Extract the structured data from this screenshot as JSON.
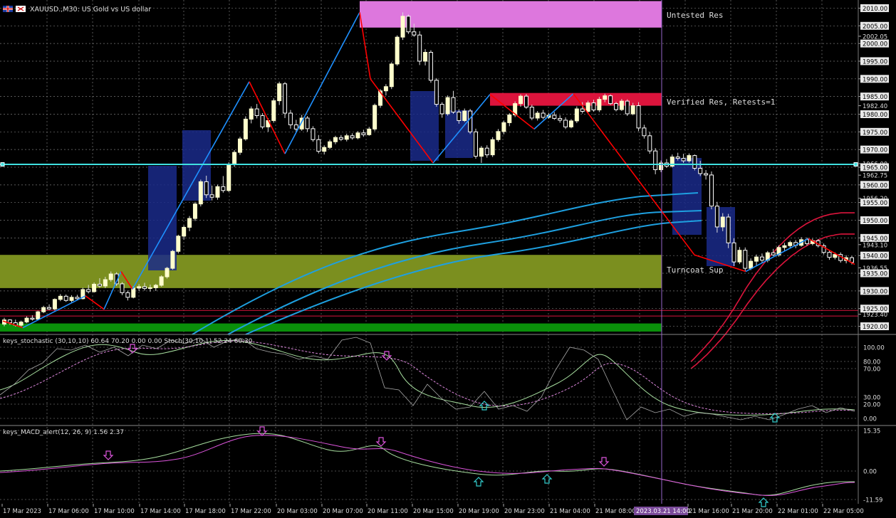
{
  "header": {
    "symbol_text": "XAUUSD.,M30:  US Gold vs US dollar",
    "flag_icon": "uk-flag-icon",
    "close_icon": "close-icon"
  },
  "annotations": {
    "untested": "Untested Res",
    "verified": "Verified Res, Retests=1",
    "turncoat": "Turncoat Sup"
  },
  "colors": {
    "background": "#000000",
    "bull_candle": "#ffffcc",
    "bear_candle": "#ffffff",
    "zigzag_up": "#1e90ff",
    "zigzag_down": "#ff0000",
    "untested_res": "#dd77dd",
    "verified_res": "#dc143c",
    "turncoat_sup": "#7b8f1f",
    "bottom_sup": "#0a8f0a",
    "cyan_line": "#40e0e0",
    "ma_blue": "#1ea0e0",
    "ma_red": "#dc143c",
    "stoch_main": "#a8e0a0",
    "stoch_signal": "#dd88dd",
    "macd_main": "#a8e0a0",
    "macd_signal": "#dd55dd",
    "box_navy": "#1a2a8a",
    "cursor_line": "#9966cc"
  },
  "price_axis": {
    "labels": [
      "2010.00",
      "2005.00",
      "2002.05",
      "2000.00",
      "1995.00",
      "1990.00",
      "1985.00",
      "1982.40",
      "1980.00",
      "1975.00",
      "1970.00",
      "1966.00",
      "1965.00",
      "1962.75",
      "1960.00",
      "1956.20",
      "1955.00",
      "1950.00",
      "1945.00",
      "1943.10",
      "1940.00",
      "1936.55",
      "1935.00",
      "1930.00",
      "1925.00",
      "1923.40",
      "1920.00"
    ],
    "range": [
      1918.5,
      2011.5
    ]
  },
  "stoch_panel": {
    "title": "keys_stochastic (30,10,10) 60.64 70.20 0.00 0.00 Stoch(30,10,1) 52.24 60.30",
    "axis": [
      "100.00",
      "80.00",
      "70.00",
      "30.00",
      "20.00",
      "0.00"
    ]
  },
  "macd_panel": {
    "title": "keys_MACD_alert(12, 26, 9) 1.56 2.37",
    "axis": [
      "15.35",
      "0.00",
      "-11.59"
    ]
  },
  "time_axis": {
    "labels": [
      "17 Mar 2023",
      "17 Mar 06:00",
      "17 Mar 10:00",
      "17 Mar 14:00",
      "17 Mar 18:00",
      "17 Mar 22:00",
      "20 Mar 03:00",
      "20 Mar 07:00",
      "20 Mar 11:00",
      "20 Mar 15:00",
      "20 Mar 19:00",
      "20 Mar 23:00",
      "21 Mar 04:00",
      "21 Mar 08:00",
      "21 Mar 16:00",
      "21 Mar 20:00",
      "22 Mar 01:00",
      "22 Mar 05:00"
    ],
    "cursor_label": "2023.03.21 14:00"
  },
  "chart_data": {
    "type": "candlestick",
    "title": "XAUUSD.,M30:  US Gold vs US dollar",
    "price_range": [
      1918.5,
      2011.5
    ],
    "horizontal_line": 1965.8,
    "zones": [
      {
        "label": "Untested Res",
        "low": 2004.5,
        "high": 2012
      },
      {
        "label": "Verified Res, Retests=1",
        "low": 1982.4,
        "high": 1986.0
      },
      {
        "label": "Turncoat Sup",
        "low": 1930.8,
        "high": 1940.2
      },
      {
        "label": "",
        "low": 1918.5,
        "high": 1920.8
      }
    ],
    "zigzag": [
      [
        0,
        1921.5
      ],
      [
        1,
        1919.6
      ],
      [
        2,
        1928.6
      ],
      [
        3,
        1924.8
      ],
      [
        4,
        1935.5
      ],
      [
        5,
        1930.5
      ],
      [
        6,
        1989.2
      ],
      [
        7,
        1968.8
      ],
      [
        8,
        2008.8
      ],
      [
        9,
        1990.0
      ],
      [
        10,
        1966.2
      ],
      [
        11,
        1985.6
      ],
      [
        12,
        1975.8
      ],
      [
        13,
        1985.8
      ],
      [
        14,
        1940.2
      ],
      [
        15,
        1935.5
      ],
      [
        16,
        1944.8
      ],
      [
        17,
        1937.5
      ]
    ],
    "candles": [
      [
        1920.6,
        1922.4,
        1920.0,
        1921.8
      ],
      [
        1921.8,
        1922.0,
        1920.4,
        1921.0
      ],
      [
        1921.0,
        1921.9,
        1919.9,
        1920.3
      ],
      [
        1920.3,
        1921.6,
        1919.7,
        1921.2
      ],
      [
        1921.2,
        1922.8,
        1920.9,
        1922.3
      ],
      [
        1922.3,
        1923.1,
        1921.6,
        1922.0
      ],
      [
        1922.0,
        1924.4,
        1921.8,
        1924.1
      ],
      [
        1924.1,
        1925.8,
        1923.7,
        1925.3
      ],
      [
        1925.3,
        1926.2,
        1924.6,
        1924.9
      ],
      [
        1924.9,
        1927.9,
        1924.5,
        1927.6
      ],
      [
        1927.6,
        1929.1,
        1927.1,
        1928.5
      ],
      [
        1928.5,
        1929.0,
        1926.9,
        1927.3
      ],
      [
        1927.3,
        1928.8,
        1926.8,
        1928.2
      ],
      [
        1928.2,
        1928.9,
        1927.4,
        1927.8
      ],
      [
        1927.8,
        1930.9,
        1927.6,
        1930.4
      ],
      [
        1930.4,
        1931.7,
        1929.3,
        1929.8
      ],
      [
        1929.8,
        1932.4,
        1929.5,
        1931.9
      ],
      [
        1931.9,
        1933.6,
        1930.9,
        1931.4
      ],
      [
        1931.4,
        1934.0,
        1930.8,
        1933.2
      ],
      [
        1933.2,
        1935.5,
        1932.6,
        1934.8
      ],
      [
        1934.8,
        1935.3,
        1931.4,
        1932.0
      ],
      [
        1932.0,
        1932.5,
        1928.8,
        1929.5
      ],
      [
        1929.5,
        1930.1,
        1927.3,
        1928.2
      ],
      [
        1928.2,
        1931.4,
        1927.9,
        1930.8
      ],
      [
        1930.8,
        1931.9,
        1930.0,
        1931.2
      ],
      [
        1931.2,
        1932.3,
        1930.1,
        1930.7
      ],
      [
        1930.7,
        1931.8,
        1929.8,
        1930.9
      ],
      [
        1930.9,
        1932.0,
        1930.0,
        1931.6
      ],
      [
        1931.6,
        1934.4,
        1931.2,
        1934.0
      ],
      [
        1934.0,
        1936.8,
        1933.5,
        1936.4
      ],
      [
        1936.4,
        1941.6,
        1936.0,
        1941.2
      ],
      [
        1941.2,
        1945.9,
        1940.6,
        1945.5
      ],
      [
        1945.5,
        1948.5,
        1944.5,
        1948.0
      ],
      [
        1948.0,
        1951.2,
        1946.9,
        1950.5
      ],
      [
        1950.5,
        1955.2,
        1949.8,
        1954.6
      ],
      [
        1954.6,
        1961.5,
        1953.9,
        1960.9
      ],
      [
        1960.9,
        1962.6,
        1956.3,
        1957.2
      ],
      [
        1957.2,
        1959.8,
        1955.6,
        1956.5
      ],
      [
        1956.5,
        1960.1,
        1955.8,
        1959.5
      ],
      [
        1959.5,
        1962.5,
        1957.8,
        1958.4
      ],
      [
        1958.4,
        1966.4,
        1958.0,
        1965.7
      ],
      [
        1965.7,
        1969.8,
        1965.1,
        1969.2
      ],
      [
        1969.2,
        1973.6,
        1968.5,
        1973.0
      ],
      [
        1973.0,
        1979.4,
        1972.5,
        1978.6
      ],
      [
        1978.6,
        1982.2,
        1977.4,
        1981.5
      ],
      [
        1981.5,
        1982.9,
        1978.8,
        1979.6
      ],
      [
        1979.6,
        1980.3,
        1975.8,
        1976.4
      ],
      [
        1976.4,
        1978.9,
        1975.0,
        1978.2
      ],
      [
        1978.2,
        1984.5,
        1977.6,
        1983.8
      ],
      [
        1983.8,
        1989.2,
        1982.6,
        1988.6
      ],
      [
        1988.6,
        1989.1,
        1978.9,
        1980.3
      ],
      [
        1980.3,
        1981.2,
        1975.9,
        1977.0
      ],
      [
        1977.0,
        1978.4,
        1974.9,
        1975.8
      ],
      [
        1975.8,
        1979.8,
        1975.3,
        1978.9
      ],
      [
        1978.9,
        1979.5,
        1975.0,
        1975.9
      ],
      [
        1975.9,
        1976.6,
        1972.2,
        1972.8
      ],
      [
        1972.8,
        1974.1,
        1968.9,
        1969.5
      ],
      [
        1969.5,
        1971.2,
        1968.6,
        1970.6
      ],
      [
        1970.6,
        1972.8,
        1970.1,
        1972.2
      ],
      [
        1972.2,
        1973.9,
        1971.5,
        1973.4
      ],
      [
        1973.4,
        1974.1,
        1972.4,
        1972.9
      ],
      [
        1972.9,
        1974.5,
        1972.3,
        1973.9
      ],
      [
        1973.9,
        1974.6,
        1972.8,
        1973.3
      ],
      [
        1973.3,
        1975.2,
        1972.9,
        1974.7
      ],
      [
        1974.7,
        1975.6,
        1973.6,
        1974.2
      ],
      [
        1974.2,
        1976.4,
        1973.9,
        1975.8
      ],
      [
        1975.8,
        1983.0,
        1975.2,
        1982.5
      ],
      [
        1982.5,
        1987.1,
        1981.8,
        1986.6
      ],
      [
        1986.6,
        1988.5,
        1985.3,
        1987.8
      ],
      [
        1987.8,
        1994.7,
        1987.1,
        1994.2
      ],
      [
        1994.2,
        2002.3,
        1993.7,
        2001.8
      ],
      [
        2001.8,
        2008.8,
        2001.0,
        2007.7
      ],
      [
        2007.7,
        2008.2,
        2002.7,
        2003.3
      ],
      [
        2003.3,
        2005.6,
        2001.9,
        2002.4
      ],
      [
        2002.4,
        2003.5,
        1993.9,
        1995.0
      ],
      [
        1995.0,
        1998.4,
        1993.8,
        1997.5
      ],
      [
        1997.5,
        1998.1,
        1988.9,
        1989.6
      ],
      [
        1989.6,
        1990.2,
        1982.1,
        1982.8
      ],
      [
        1982.8,
        1983.4,
        1979.0,
        1980.1
      ],
      [
        1980.1,
        1985.3,
        1979.6,
        1984.7
      ],
      [
        1984.7,
        1986.6,
        1980.1,
        1980.6
      ],
      [
        1980.6,
        1981.4,
        1977.3,
        1978.2
      ],
      [
        1978.2,
        1981.6,
        1977.8,
        1980.9
      ],
      [
        1980.9,
        1981.5,
        1974.4,
        1975.0
      ],
      [
        1975.0,
        1975.9,
        1967.4,
        1968.1
      ],
      [
        1968.1,
        1971.0,
        1966.2,
        1970.4
      ],
      [
        1970.4,
        1971.2,
        1967.7,
        1968.5
      ],
      [
        1968.5,
        1973.5,
        1967.9,
        1972.8
      ],
      [
        1972.8,
        1975.8,
        1972.2,
        1975.1
      ],
      [
        1975.1,
        1978.2,
        1974.3,
        1977.6
      ],
      [
        1977.6,
        1980.3,
        1976.6,
        1979.8
      ],
      [
        1979.8,
        1983.6,
        1979.2,
        1983.0
      ],
      [
        1983.0,
        1985.6,
        1982.1,
        1985.1
      ],
      [
        1985.1,
        1985.7,
        1981.5,
        1982.0
      ],
      [
        1982.0,
        1982.7,
        1978.3,
        1978.9
      ],
      [
        1978.9,
        1980.9,
        1978.2,
        1980.3
      ],
      [
        1980.3,
        1981.2,
        1978.6,
        1979.1
      ],
      [
        1979.1,
        1980.4,
        1978.7,
        1979.7
      ],
      [
        1979.7,
        1980.6,
        1978.4,
        1978.8
      ],
      [
        1978.8,
        1979.7,
        1977.6,
        1978.3
      ],
      [
        1978.3,
        1979.1,
        1975.8,
        1976.4
      ],
      [
        1976.4,
        1978.6,
        1976.0,
        1978.1
      ],
      [
        1978.1,
        1982.2,
        1977.5,
        1981.5
      ],
      [
        1981.5,
        1983.4,
        1980.2,
        1980.8
      ],
      [
        1980.8,
        1983.8,
        1980.3,
        1983.2
      ],
      [
        1983.2,
        1984.1,
        1980.7,
        1981.2
      ],
      [
        1981.2,
        1984.9,
        1980.6,
        1984.2
      ],
      [
        1984.2,
        1985.8,
        1983.4,
        1985.2
      ],
      [
        1985.2,
        1985.6,
        1982.6,
        1983.0
      ],
      [
        1983.0,
        1983.5,
        1980.8,
        1981.3
      ],
      [
        1981.3,
        1984.3,
        1980.9,
        1983.7
      ],
      [
        1983.7,
        1984.2,
        1979.5,
        1980.1
      ],
      [
        1980.1,
        1983.2,
        1979.7,
        1982.4
      ],
      [
        1982.4,
        1983.4,
        1975.2,
        1976.1
      ],
      [
        1976.1,
        1977.0,
        1973.1,
        1973.9
      ],
      [
        1973.9,
        1975.0,
        1968.8,
        1969.6
      ],
      [
        1969.6,
        1970.4,
        1963.0,
        1964.3
      ],
      [
        1964.3,
        1966.9,
        1963.6,
        1966.2
      ],
      [
        1966.2,
        1967.3,
        1964.8,
        1965.3
      ],
      [
        1965.3,
        1968.6,
        1964.9,
        1967.9
      ],
      [
        1967.9,
        1969.1,
        1966.9,
        1967.5
      ],
      [
        1967.5,
        1968.8,
        1966.2,
        1966.8
      ],
      [
        1966.8,
        1968.9,
        1966.3,
        1968.3
      ],
      [
        1968.3,
        1968.6,
        1964.1,
        1964.7
      ],
      [
        1964.7,
        1966.8,
        1962.5,
        1963.2
      ],
      [
        1963.2,
        1964.2,
        1961.5,
        1962.8
      ],
      [
        1962.8,
        1963.8,
        1953.1,
        1954.0
      ],
      [
        1954.0,
        1955.2,
        1946.5,
        1948.1
      ],
      [
        1948.1,
        1952.0,
        1946.9,
        1950.9
      ],
      [
        1950.9,
        1951.8,
        1942.1,
        1943.6
      ],
      [
        1943.6,
        1944.9,
        1937.0,
        1938.2
      ],
      [
        1938.2,
        1942.4,
        1937.6,
        1941.5
      ],
      [
        1941.5,
        1942.3,
        1935.5,
        1936.4
      ],
      [
        1936.4,
        1939.2,
        1935.9,
        1938.4
      ],
      [
        1938.4,
        1940.3,
        1937.1,
        1939.6
      ],
      [
        1939.6,
        1940.6,
        1938.0,
        1938.7
      ],
      [
        1938.7,
        1941.3,
        1938.1,
        1940.8
      ],
      [
        1940.8,
        1941.9,
        1939.9,
        1940.2
      ],
      [
        1940.2,
        1942.9,
        1939.7,
        1942.3
      ],
      [
        1942.3,
        1943.6,
        1941.4,
        1942.8
      ],
      [
        1942.8,
        1944.2,
        1942.2,
        1943.7
      ],
      [
        1943.7,
        1944.4,
        1942.1,
        1942.9
      ],
      [
        1942.9,
        1945.2,
        1942.5,
        1944.5
      ],
      [
        1944.5,
        1945.1,
        1942.8,
        1943.4
      ],
      [
        1943.4,
        1944.8,
        1942.9,
        1944.2
      ],
      [
        1944.2,
        1944.7,
        1942.3,
        1942.8
      ],
      [
        1942.8,
        1943.4,
        1940.3,
        1940.9
      ],
      [
        1940.9,
        1941.6,
        1938.8,
        1939.5
      ],
      [
        1939.5,
        1940.9,
        1938.9,
        1940.3
      ],
      [
        1940.3,
        1940.9,
        1938.0,
        1938.6
      ],
      [
        1938.6,
        1940.1,
        1937.8,
        1939.4
      ],
      [
        1939.4,
        1939.9,
        1937.5,
        1938.1
      ]
    ],
    "moving_averages": [
      {
        "color": "ma_red",
        "values": [
          1910.0,
          1910.7,
          1911.5,
          1912.3,
          1913.1,
          1913.9,
          1914.8,
          1915.6,
          1916.5,
          1917.5,
          1918.5,
          1919.5,
          1920.5,
          1921.6,
          1922.7,
          1923.9,
          1925.0,
          1926.3,
          1927.5,
          1928.8,
          1930.1,
          1931.3,
          1932.4,
          1933.5,
          1934.6,
          1935.6,
          1936.6,
          1937.6,
          1938.5,
          1939.4,
          1940.3,
          1941.1,
          1942.0,
          1942.8,
          1943.5,
          1944.3,
          1945.0,
          1945.7,
          1946.3,
          1946.9,
          1947.5,
          1948.0,
          1948.5,
          1949.0,
          1949.4,
          1949.8,
          1950.2,
          1950.5,
          1950.8,
          1951.1,
          1951.3,
          1951.5,
          1951.7,
          1951.8,
          1951.9,
          1952.0,
          1952.1,
          1952.1,
          1952.1,
          1952.1,
          1952.1,
          1952.1
        ]
      },
      {
        "color": "ma_red",
        "values": [
          1908.0,
          1908.6,
          1909.2,
          1909.9,
          1910.6,
          1911.3,
          1912.0,
          1912.8,
          1913.6,
          1914.4,
          1915.3,
          1916.1,
          1917.0,
          1917.9,
          1918.9,
          1919.9,
          1920.9,
          1921.9,
          1923.0,
          1924.1,
          1925.2,
          1926.3,
          1927.3,
          1928.3,
          1929.3,
          1930.3,
          1931.2,
          1932.1,
          1933.0,
          1933.8,
          1934.6,
          1935.4,
          1936.2,
          1936.9,
          1937.6,
          1938.3,
          1938.9,
          1939.6,
          1940.2,
          1940.7,
          1941.3,
          1941.8,
          1942.3,
          1942.7,
          1943.2,
          1943.6,
          1944.0,
          1944.3,
          1944.6,
          1944.9,
          1945.2,
          1945.4,
          1945.6,
          1945.7,
          1945.9,
          1946.0,
          1946.1,
          1946.1,
          1946.1,
          1946.1,
          1946.1,
          1946.1
        ]
      }
    ]
  }
}
